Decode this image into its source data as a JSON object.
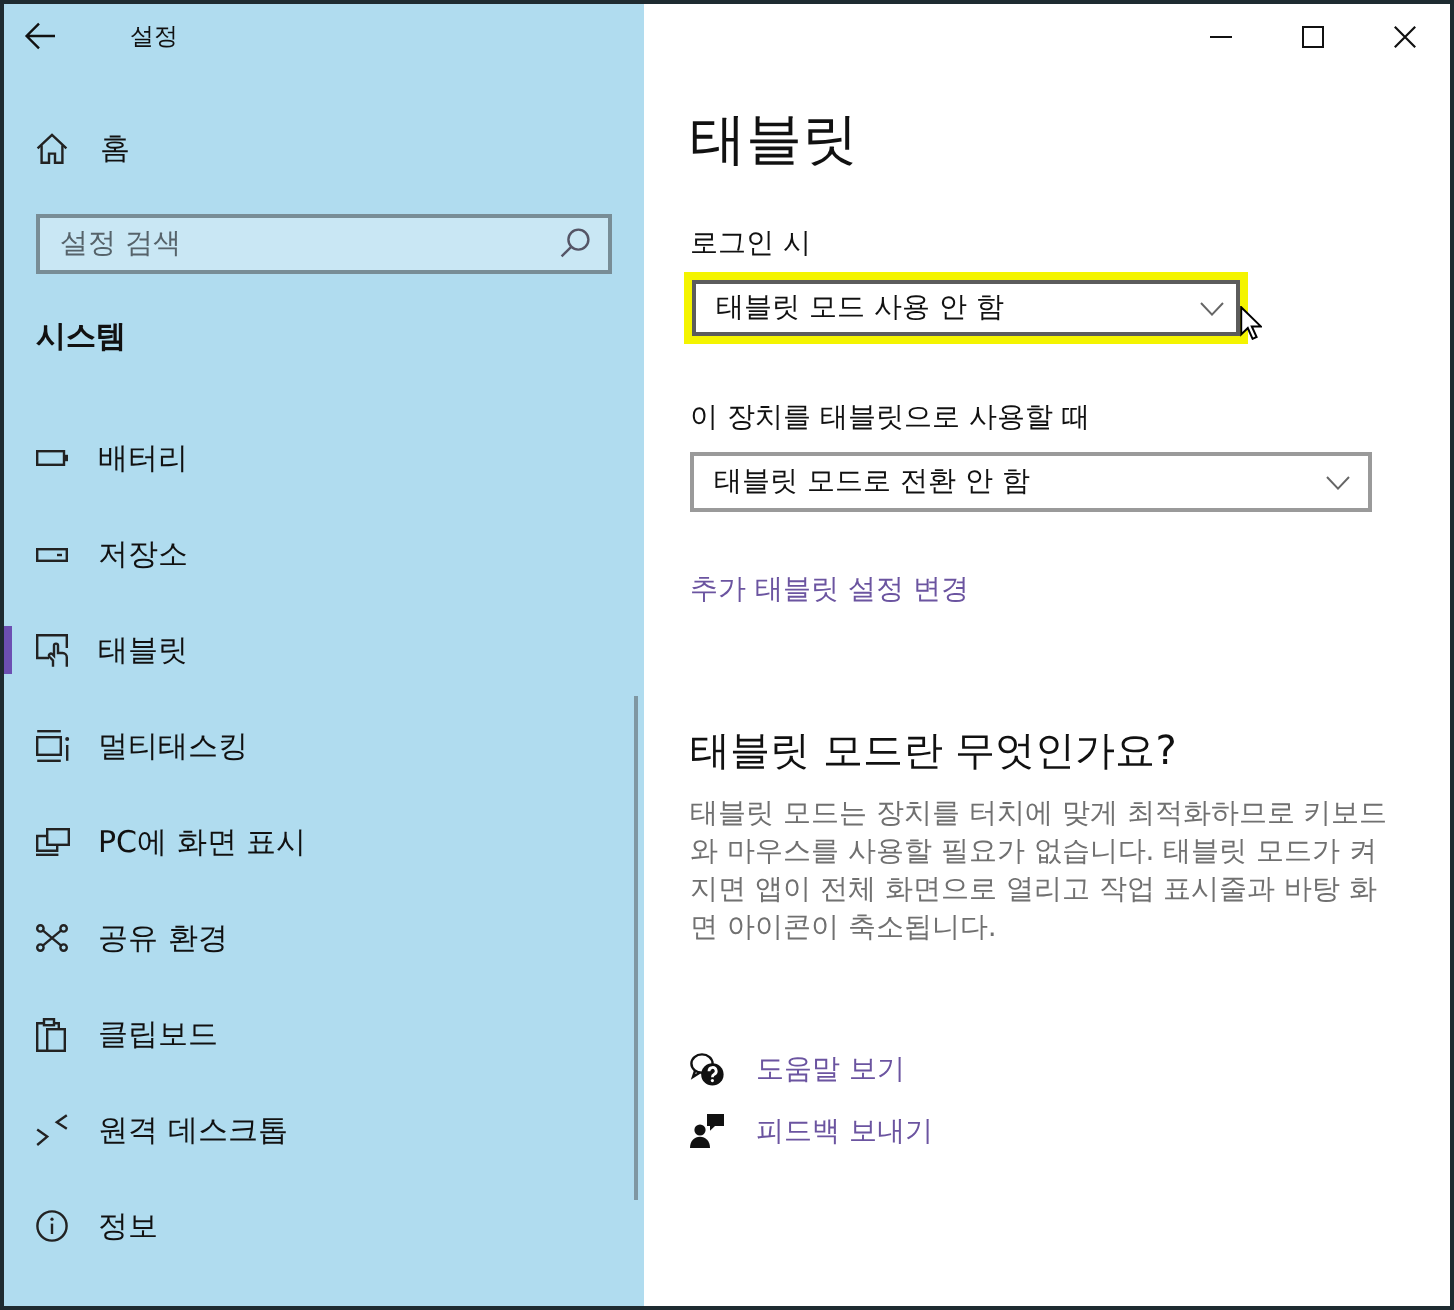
{
  "window": {
    "title": "설정"
  },
  "sidebar": {
    "home": "홈",
    "search": {
      "placeholder": "설정 검색"
    },
    "section": "시스템",
    "items": [
      {
        "label": "배터리",
        "kind": "battery",
        "selected": false
      },
      {
        "label": "저장소",
        "kind": "storage",
        "selected": false
      },
      {
        "label": "태블릿",
        "kind": "tablet",
        "selected": true
      },
      {
        "label": "멀티태스킹",
        "kind": "multitasking",
        "selected": false
      },
      {
        "label": "PC에 화면 표시",
        "kind": "projecting",
        "selected": false
      },
      {
        "label": "공유 환경",
        "kind": "shared",
        "selected": false
      },
      {
        "label": "클립보드",
        "kind": "clipboard",
        "selected": false
      },
      {
        "label": "원격 데스크톱",
        "kind": "remote",
        "selected": false
      },
      {
        "label": "정보",
        "kind": "about",
        "selected": false
      }
    ]
  },
  "content": {
    "title": "태블릿",
    "settings": [
      {
        "label": "로그인 시",
        "value": "태블릿 모드 사용 안 함",
        "highlighted": true,
        "hovered": true
      },
      {
        "label": "이 장치를 태블릿으로 사용할 때",
        "value": "태블릿 모드로 전환 안 함",
        "highlighted": false,
        "hovered": false
      }
    ],
    "link": "추가 태블릿 설정 변경",
    "about": {
      "heading": "태블릿 모드란 무엇인가요?",
      "text": "태블릿 모드는 장치를 터치에 맞게 최적화하므로 키보드와 마우스를 사용할 필요가 없습니다. 태블릿 모드가 켜지면 앱이 전체 화면으로 열리고 작업 표시줄과 바탕 화면 아이콘이 축소됩니다."
    },
    "help_links": [
      {
        "label": "도움말 보기",
        "kind": "help"
      },
      {
        "label": "피드백 보내기",
        "kind": "feedback"
      }
    ]
  }
}
